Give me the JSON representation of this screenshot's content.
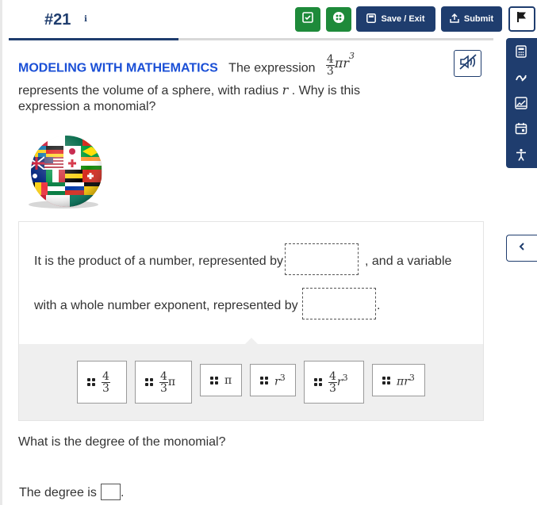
{
  "header": {
    "question_number": "#21",
    "info_symbol": "i",
    "progress_percent": 35,
    "save_exit_label": "Save / Exit",
    "submit_label": "Submit"
  },
  "prompt": {
    "heading": "MODELING WITH MATHEMATICS",
    "line1": "The expression",
    "expr_num": "4",
    "expr_den": "3",
    "expr_rest": "πr",
    "expr_exp": "3",
    "line2a": "represents the volume of  a sphere, with radius ",
    "line2_var": "r",
    "line2b": " . Why is this",
    "line3": "expression a monomial?"
  },
  "activity": {
    "sentence1_a": "It is the product of a number, represented by",
    "sentence1_b": ", and a variable",
    "sentence2_a": "with a whole number exponent, represented by",
    "sentence2_b": "."
  },
  "tiles": [
    {
      "num": "4",
      "den": "3",
      "rest": "",
      "exp": ""
    },
    {
      "num": "4",
      "den": "3",
      "rest": "π",
      "exp": ""
    },
    {
      "num": "",
      "den": "",
      "rest": "π",
      "exp": ""
    },
    {
      "num": "",
      "den": "",
      "rest": "r",
      "exp": "3"
    },
    {
      "num": "4",
      "den": "3",
      "rest": "r",
      "exp": "3"
    },
    {
      "num": "",
      "den": "",
      "rest": "πr",
      "exp": "3"
    }
  ],
  "question2": "What is the degree of the monomial?",
  "question3_a": "The degree is",
  "question3_b": ".",
  "colors": {
    "navy": "#1f3d6e",
    "green": "#1e8a3a",
    "heading_blue": "#1a4fd6",
    "tray_gray": "#efefef"
  },
  "icons": {
    "check_button": "checklist-icon",
    "reference_button": "reference-sheet-icon",
    "save": "save-icon",
    "submit": "upload-icon",
    "flag": "flag-icon",
    "calculator": "calculator-icon",
    "highlighter": "highlighter-icon",
    "line_reader": "line-reader-icon",
    "calendar": "calendar-icon",
    "accessibility": "accessibility-icon",
    "collapse": "chevron-left-icon",
    "audio": "audio-muted-icon"
  }
}
